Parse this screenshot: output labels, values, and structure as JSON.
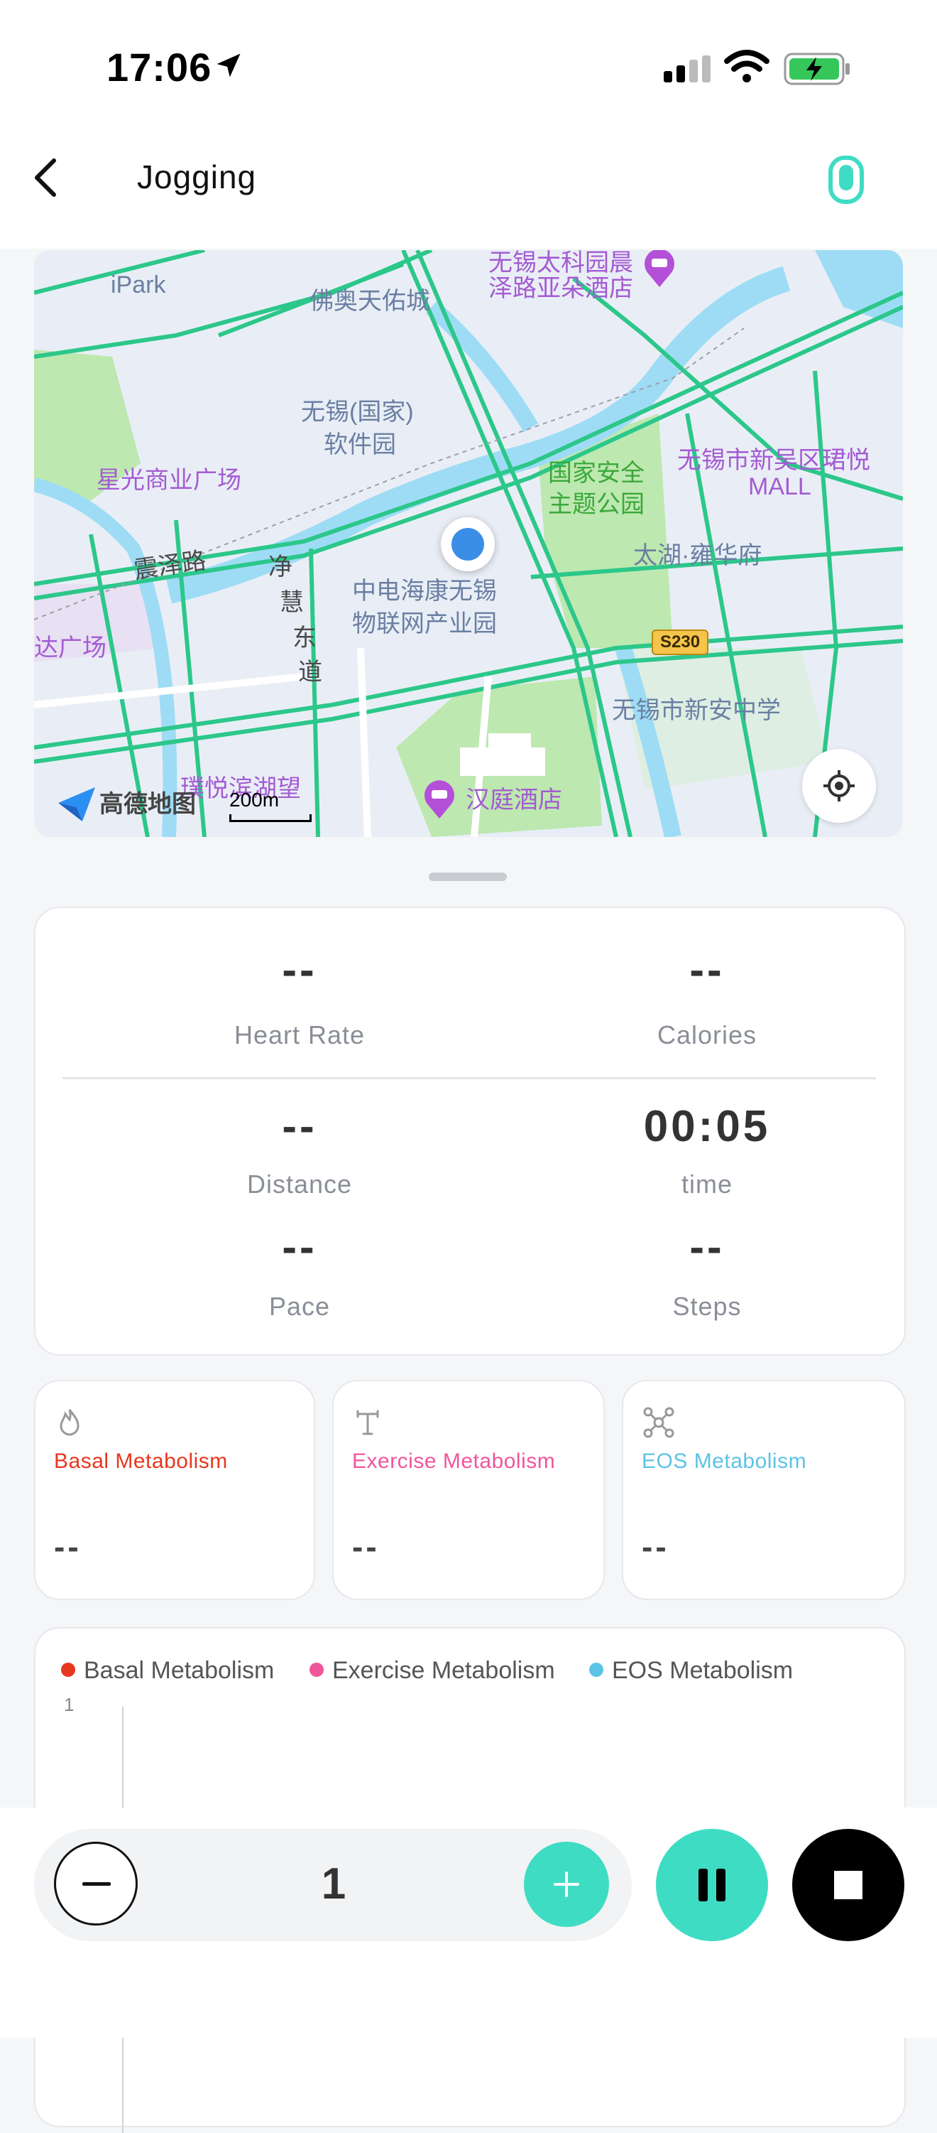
{
  "status_bar": {
    "time": "17:06"
  },
  "header": {
    "title": "Jogging"
  },
  "map": {
    "labels": [
      "iPark",
      "佛奥天佑城",
      "无锡太科园晨",
      "泽路亚朵酒店",
      "无锡(国家)",
      "软件园",
      "星光商业广场",
      "国家安全",
      "主题公园",
      "无锡市新吴区珺悦",
      "MALL",
      "震泽路",
      "净",
      "慧",
      "东",
      "道",
      "太湖·雍华府",
      "中电海康无锡",
      "物联网产业园",
      "达广场",
      "无锡市新安中学",
      "璞悦滨湖望",
      "汉庭酒店"
    ],
    "road_badge": "S230",
    "scale": "200m",
    "logo": "高德地图"
  },
  "stats": {
    "heart_rate": {
      "value": "--",
      "label": "Heart Rate"
    },
    "calories": {
      "value": "--",
      "label": "Calories"
    },
    "distance": {
      "value": "--",
      "label": "Distance"
    },
    "time": {
      "value": "00:05",
      "label": "time"
    },
    "pace": {
      "value": "--",
      "label": "Pace"
    },
    "steps": {
      "value": "--",
      "label": "Steps"
    }
  },
  "metabolism": [
    {
      "title": "Basal Metabolism",
      "value": "--",
      "color": "#e8371f",
      "icon": "flame-icon"
    },
    {
      "title": "Exercise Metabolism",
      "value": "--",
      "color": "#f0569a",
      "icon": "dumbbell-icon"
    },
    {
      "title": "EOS Metabolism",
      "value": "--",
      "color": "#5cc3e6",
      "icon": "molecule-icon"
    }
  ],
  "chart": {
    "legend": [
      {
        "name": "Basal Metabolism",
        "color": "#e8371f"
      },
      {
        "name": "Exercise Metabolism",
        "color": "#f0569a"
      },
      {
        "name": "EOS Metabolism",
        "color": "#5cc3e6"
      }
    ],
    "y_tick": "1"
  },
  "controls": {
    "count": "1"
  }
}
